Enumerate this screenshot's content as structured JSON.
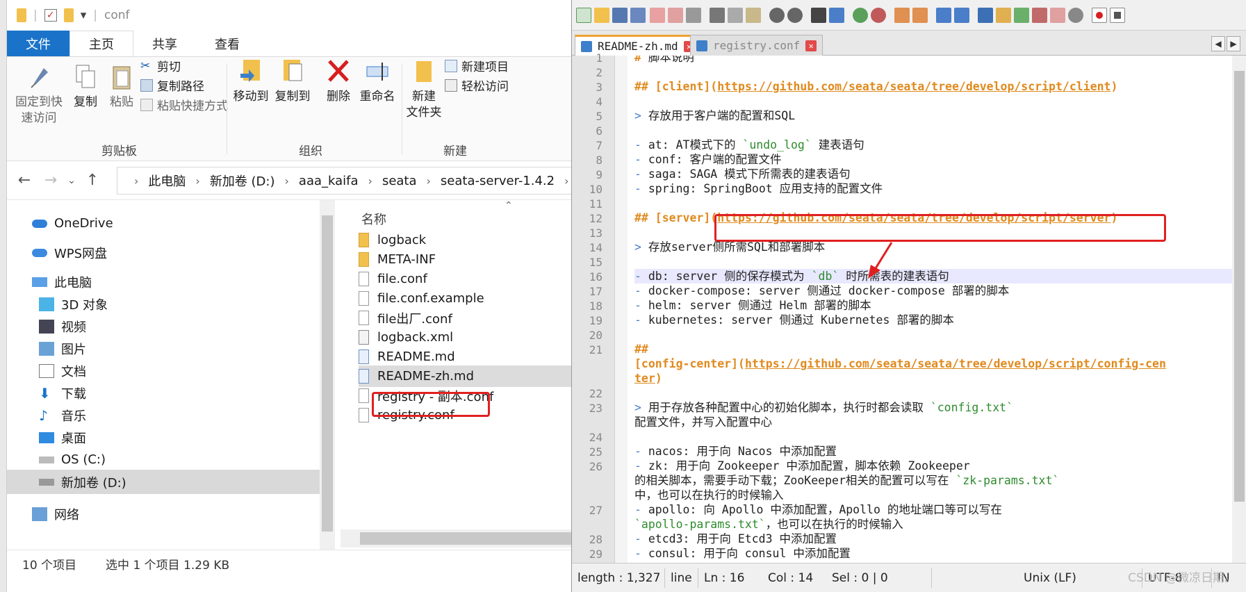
{
  "explorer": {
    "title": "conf",
    "tabs": [
      "文件",
      "主页",
      "共享",
      "查看"
    ],
    "ribbon": {
      "clipboard": {
        "pin": "固定到快\n速访问",
        "copy": "复制",
        "paste": "粘贴",
        "cut": "剪切",
        "copy_path": "复制路径",
        "paste_shortcut": "粘贴快捷方式",
        "label": "剪贴板"
      },
      "organize": {
        "move_to": "移动到",
        "copy_to": "复制到",
        "delete": "删除",
        "rename": "重命名",
        "label": "组织"
      },
      "new": {
        "new_folder": "新建\n文件夹",
        "new_item": "新建项目",
        "easy_access": "轻松访问",
        "label": "新建"
      }
    },
    "address": [
      "此电脑",
      "新加卷 (D:)",
      "aaa_kaifa",
      "seata",
      "seata-server-1.4.2",
      "con"
    ],
    "nav": [
      {
        "label": "OneDrive"
      },
      {
        "label": "WPS网盘"
      },
      {
        "label": "此电脑"
      },
      {
        "label": "3D 对象"
      },
      {
        "label": "视频"
      },
      {
        "label": "图片"
      },
      {
        "label": "文档"
      },
      {
        "label": "下载"
      },
      {
        "label": "音乐"
      },
      {
        "label": "桌面"
      },
      {
        "label": "OS (C:)"
      },
      {
        "label": "新加卷 (D:)"
      },
      {
        "label": "网络"
      }
    ],
    "column_name": "名称",
    "files": [
      "logback",
      "META-INF",
      "file.conf",
      "file.conf.example",
      "file出厂.conf",
      "logback.xml",
      "README.md",
      "README-zh.md",
      "registry - 副本.conf",
      "registry.conf"
    ],
    "status": {
      "count": "10 个项目",
      "selected": "选中 1 个项目  1.29 KB"
    }
  },
  "editor": {
    "tabs": [
      "README-zh.md",
      "registry.conf"
    ],
    "lines": [
      {
        "n": "1",
        "t": "# 脚本说明"
      },
      {
        "n": "2",
        "t": ""
      },
      {
        "n": "3",
        "t": "## [client](https://github.com/seata/seata/tree/develop/script/client)"
      },
      {
        "n": "4",
        "t": ""
      },
      {
        "n": "5",
        "t": "> 存放用于客户端的配置和SQL"
      },
      {
        "n": "6",
        "t": ""
      },
      {
        "n": "7",
        "t": "- at: AT模式下的 `undo_log` 建表语句"
      },
      {
        "n": "8",
        "t": "- conf: 客户端的配置文件"
      },
      {
        "n": "9",
        "t": "- saga: SAGA 模式下所需表的建表语句"
      },
      {
        "n": "10",
        "t": "- spring: SpringBoot 应用支持的配置文件"
      },
      {
        "n": "11",
        "t": ""
      },
      {
        "n": "12",
        "t": "## [server](https://github.com/seata/seata/tree/develop/script/server)"
      },
      {
        "n": "13",
        "t": ""
      },
      {
        "n": "14",
        "t": "> 存放server侧所需SQL和部署脚本"
      },
      {
        "n": "15",
        "t": ""
      },
      {
        "n": "16",
        "t": "- db: server 侧的保存模式为 `db` 时所需表的建表语句"
      },
      {
        "n": "17",
        "t": "- docker-compose: server 侧通过 docker-compose 部署的脚本"
      },
      {
        "n": "18",
        "t": "- helm: server 侧通过 Helm 部署的脚本"
      },
      {
        "n": "19",
        "t": "- kubernetes: server 侧通过 Kubernetes 部署的脚本"
      },
      {
        "n": "20",
        "t": ""
      },
      {
        "n": "21",
        "t": "##"
      },
      {
        "n": "",
        "t": "[config-center](https://github.com/seata/seata/tree/develop/script/config-cen"
      },
      {
        "n": "",
        "t": "ter)"
      },
      {
        "n": "22",
        "t": ""
      },
      {
        "n": "23",
        "t": "> 用于存放各种配置中心的初始化脚本，执行时都会读取 `config.txt`"
      },
      {
        "n": "",
        "t": "配置文件，并写入配置中心"
      },
      {
        "n": "24",
        "t": ""
      },
      {
        "n": "25",
        "t": "- nacos: 用于向 Nacos 中添加配置"
      },
      {
        "n": "26",
        "t": "- zk: 用于向 Zookeeper 中添加配置，脚本依赖 Zookeeper"
      },
      {
        "n": "",
        "t": "的相关脚本，需要手动下载；ZooKeeper相关的配置可以写在 `zk-params.txt`"
      },
      {
        "n": "",
        "t": "中，也可以在执行的时候输入"
      },
      {
        "n": "27",
        "t": "- apollo: 向 Apollo 中添加配置，Apollo 的地址端口等可以写在"
      },
      {
        "n": "",
        "t": "`apollo-params.txt`，也可以在执行的时候输入"
      },
      {
        "n": "28",
        "t": "- etcd3: 用于向 Etcd3 中添加配置"
      },
      {
        "n": "29",
        "t": "- consul: 用于向 consul 中添加配置"
      }
    ],
    "status": {
      "length": "length : 1,327",
      "lines": "line",
      "ln": "Ln : 16",
      "col": "Col : 14",
      "sel": "Sel : 0 | 0",
      "eol": "Unix (LF)",
      "enc": "UTF-8",
      "mode": "IN"
    }
  },
  "watermark": "CSDN @微凉日期。"
}
